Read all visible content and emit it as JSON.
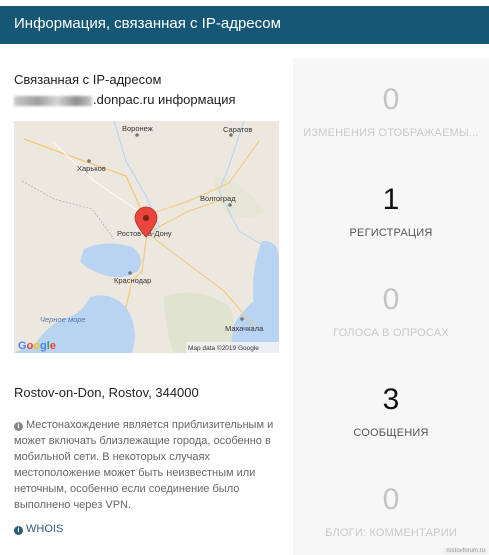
{
  "header": {
    "title": "Информация, связанная с IP-адресом"
  },
  "info": {
    "line1": "Связанная с IP-адресом",
    "line2_suffix": ".donpac.ru информация",
    "location": "Rostov-on-Don, Rostov, 344000",
    "note": "Местонахождение является приблизительным и может включать близлежащие города, особенно в мобильной сети. В некоторых случаях местоположение может быть неизвестным или неточным, особенно если соединение было выполнено через VPN.",
    "whois_label": "WHOIS"
  },
  "map": {
    "cities": [
      "Воронеж",
      "Саратов",
      "Харьков",
      "Волгоград",
      "Ростов-на-Дону",
      "Краснодар",
      "Махачкала"
    ],
    "sea_label": "Черное море",
    "logo": "Google",
    "attribution": "Map data ©2019 Google"
  },
  "stats": [
    {
      "value": "0",
      "label": "ИЗМЕНЕНИЯ ОТОБРАЖАЕМЫ..."
    },
    {
      "value": "1",
      "label": "РЕГИСТРАЦИЯ"
    },
    {
      "value": "0",
      "label": "ГОЛОСА В ОПРОСАХ"
    },
    {
      "value": "3",
      "label": "СООБЩЕНИЯ"
    },
    {
      "value": "0",
      "label": "БЛОГИ: КОММЕНТАРИИ"
    }
  ],
  "watermark": "rostovforum.ru",
  "colors": {
    "header_bg": "#155775",
    "stat_faded": "#c4c4c4",
    "stat_active": "#111111",
    "link": "#2d5d7b"
  }
}
